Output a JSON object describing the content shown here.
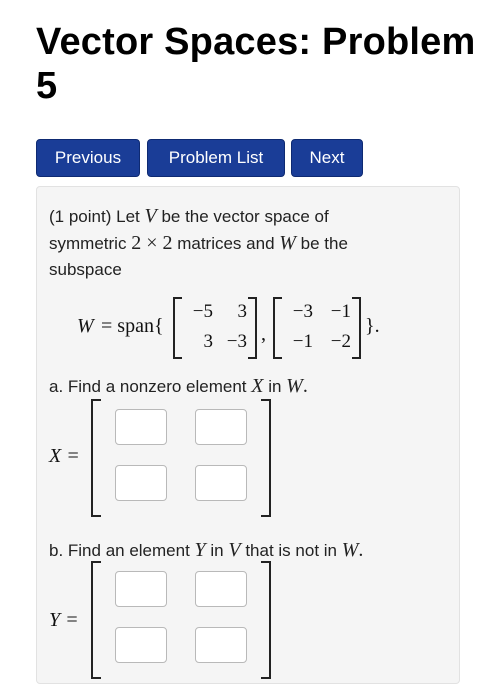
{
  "header": {
    "title": "Vector Spaces: Problem 5"
  },
  "nav": {
    "previous": "Previous",
    "problem_list": "Problem List",
    "next": "Next"
  },
  "problem": {
    "points": "(1 point)",
    "intro_1": "Let",
    "var_V": "V",
    "intro_2": "be the vector space of",
    "intro_3": "symmetric",
    "dims": "2 × 2",
    "intro_4": "matrices and",
    "var_W": "W",
    "intro_5": "be the",
    "intro_6": "subspace",
    "formula": {
      "lhs": "W",
      "eq_span": "= span{",
      "close": "}.",
      "comma": ",",
      "matrix1": [
        [
          "−5",
          "3"
        ],
        [
          "3",
          "−3"
        ]
      ],
      "matrix2": [
        [
          "−3",
          "−1"
        ],
        [
          "−1",
          "−2"
        ]
      ]
    },
    "part_a": {
      "text1": "a. Find a nonzero element",
      "X": "X",
      "text2": "in",
      "W": "W",
      "end": ".",
      "lhs": "X ="
    },
    "part_b": {
      "text1": "b. Find an element",
      "Y": "Y",
      "text2": "in",
      "V": "V",
      "text3": "that is not in",
      "W": "W",
      "end": ".",
      "lhs": "Y ="
    }
  }
}
